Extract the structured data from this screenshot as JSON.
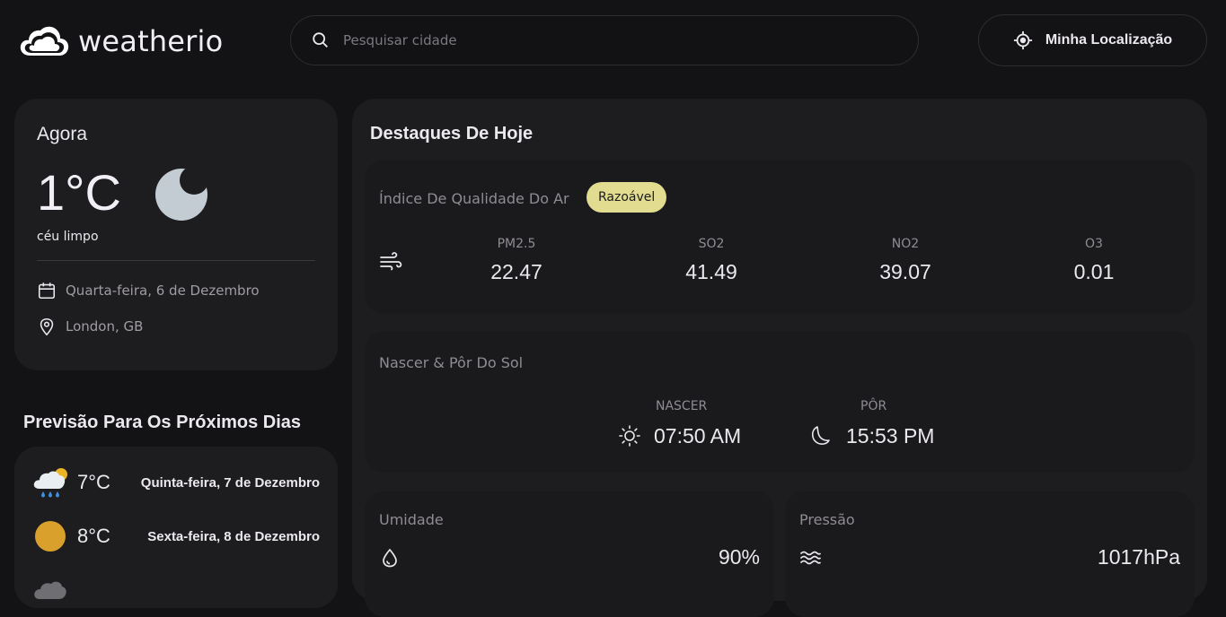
{
  "header": {
    "logo_text": "weatherio",
    "search_placeholder": "Pesquisar cidade",
    "location_button": "Minha Localização"
  },
  "current": {
    "title": "Agora",
    "temperature": "1°C",
    "description": "céu limpo",
    "date": "Quarta-feira, 6 de Dezembro",
    "location": "London, GB",
    "icon": "moon-icon"
  },
  "forecast": {
    "title": "Previsão Para Os Próximos Dias",
    "days": [
      {
        "temp": "7°C",
        "date": "Quinta-feira, 7 de Dezembro",
        "icon": "rain-cloud-sun-icon"
      },
      {
        "temp": "8°C",
        "date": "Sexta-feira, 8 de Dezembro",
        "icon": "sun-icon"
      }
    ]
  },
  "highlights": {
    "title": "Destaques De Hoje",
    "air_quality": {
      "title": "Índice De Qualidade Do Ar",
      "badge": "Razoável",
      "badge_color": "#e2dc91",
      "items": [
        {
          "label": "PM2.5",
          "value": "22.47"
        },
        {
          "label": "SO2",
          "value": "41.49"
        },
        {
          "label": "NO2",
          "value": "39.07"
        },
        {
          "label": "O3",
          "value": "0.01"
        }
      ]
    },
    "sun": {
      "title": "Nascer & Pôr Do Sol",
      "sunrise_label": "NASCER",
      "sunrise": "07:50 AM",
      "sunset_label": "PÔR",
      "sunset": "15:53 PM"
    },
    "humidity": {
      "title": "Umidade",
      "value": "90%"
    },
    "pressure": {
      "title": "Pressão",
      "value": "1017hPa"
    }
  }
}
